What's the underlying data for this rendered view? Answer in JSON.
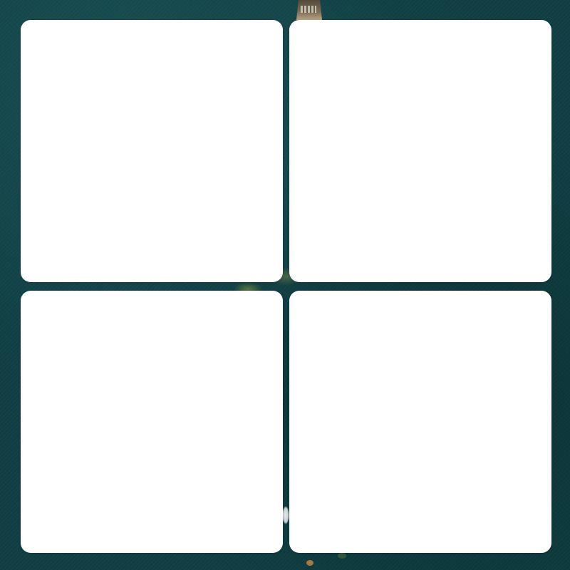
{
  "wallpaper": {
    "description_color": "#103f43"
  },
  "panels": {
    "top_left": {
      "content": ""
    },
    "top_right": {
      "content": ""
    },
    "bottom_left": {
      "content": ""
    },
    "bottom_right": {
      "content": ""
    }
  }
}
